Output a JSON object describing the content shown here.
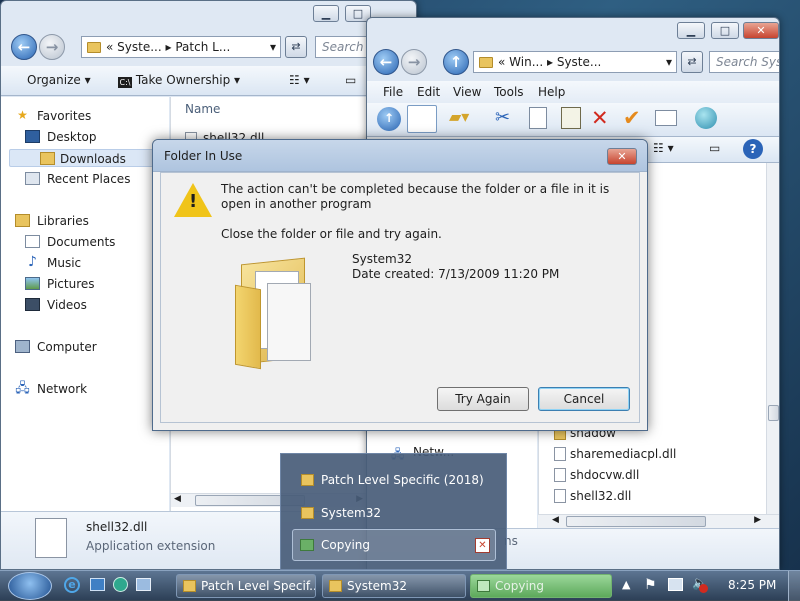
{
  "left_window": {
    "address_prefix": "«",
    "address_crumbs": [
      "Syste...",
      "Patch L..."
    ],
    "search_placeholder": "Search Pa",
    "toolbar": {
      "organize": "Organize",
      "take_ownership": "Take Ownership"
    },
    "nav": {
      "favorites": "Favorites",
      "desktop": "Desktop",
      "downloads": "Downloads",
      "recent_places": "Recent Places",
      "libraries": "Libraries",
      "documents": "Documents",
      "music": "Music",
      "pictures": "Pictures",
      "videos": "Videos",
      "computer": "Computer",
      "network": "Network"
    },
    "column_name": "Name",
    "file_row": "shell32.dll",
    "details": {
      "filename": "shell32.dll",
      "filetype": "Application extension"
    }
  },
  "right_window": {
    "address_prefix": "«",
    "address_crumbs": [
      "Win...",
      "Syste..."
    ],
    "search_placeholder": "Search Syst",
    "menu": {
      "file": "File",
      "edit": "Edit",
      "view": "View",
      "tools": "Tools",
      "help": "Help"
    },
    "nav_network_partial": "Netw...",
    "files": [
      "shadow",
      "sharemediacpl.dll",
      "shdocvw.dll",
      "shell32.dll"
    ],
    "status_partial": "ns"
  },
  "dialog": {
    "title": "Folder In Use",
    "message": "The action can't be completed because the folder or a file in it is open in another program",
    "instruction": "Close the folder or file and try again.",
    "folder_name": "System32",
    "date_created": "Date created: 7/13/2009 11:20 PM",
    "try_again": "Try Again",
    "cancel": "Cancel"
  },
  "popup": {
    "items": [
      "Patch Level Specific (2018)",
      "System32",
      "Copying"
    ]
  },
  "taskbar": {
    "buttons": [
      "Patch Level Specif...",
      "System32",
      "Copying"
    ],
    "time": "8:25 PM"
  },
  "colors": {
    "accent": "#3c7fb1",
    "close_red": "#c7442f",
    "folder_yellow": "#e9c45e",
    "taskbar_green": "#5da95b"
  },
  "icons": [
    "favorites-star-icon",
    "desktop-icon",
    "downloads-folder-icon",
    "recent-places-icon",
    "libraries-icon",
    "documents-icon",
    "music-note-icon",
    "pictures-icon",
    "videos-icon",
    "computer-icon",
    "network-icon",
    "warning-icon",
    "folder-icon",
    "dll-file-icon",
    "cut-icon",
    "copy-icon",
    "paste-icon",
    "delete-icon",
    "check-icon",
    "windows-start-icon",
    "ie-icon",
    "flag-icon",
    "speaker-muted-icon"
  ]
}
